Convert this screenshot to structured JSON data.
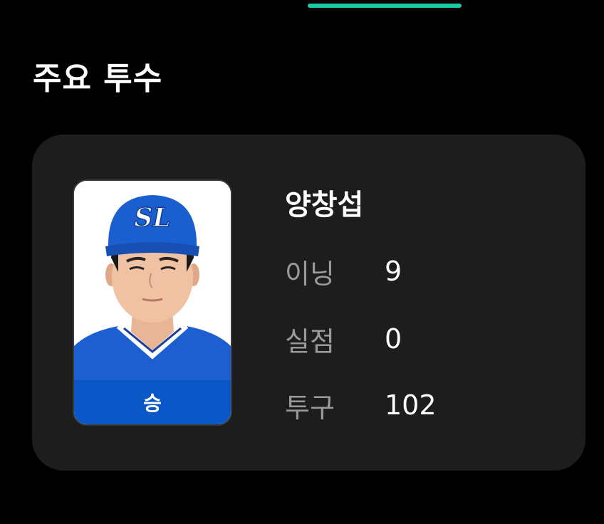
{
  "section": {
    "title": "주요 투수"
  },
  "pitcher": {
    "name": "양창섭",
    "result": "승",
    "cap_logo": "SL",
    "stats": [
      {
        "label": "이닝",
        "value": "9"
      },
      {
        "label": "실점",
        "value": "0"
      },
      {
        "label": "투구",
        "value": "102"
      }
    ]
  },
  "colors": {
    "tab_indicator": "#19c9a0",
    "card_background": "#1d1d1d",
    "badge_background": "#0a58c8",
    "cap": "#1a5fd0"
  }
}
